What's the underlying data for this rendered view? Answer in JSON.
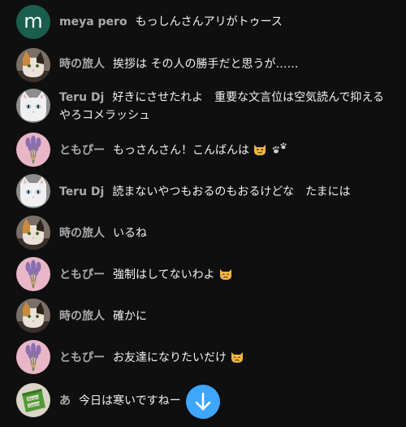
{
  "messages": [
    {
      "author": "meya pero",
      "text": "もっしんさんアリがトゥース",
      "avatar": "letter-m-avatar",
      "avatar_letter": "m"
    },
    {
      "author": "時の旅人",
      "text": "挨拶は その人の勝手だと思うが……",
      "avatar": "calico-cat-avatar"
    },
    {
      "author": "Teru Dj",
      "text": "好きにさせたれよ　重要な文言位は空気読んで抑えるやろコメラッシュ",
      "avatar": "white-cat-avatar"
    },
    {
      "author": "ともぴー",
      "text": "もっさんさん！こんばんは",
      "avatar": "lavender-avatar",
      "emoji": [
        "smiling-cat-emoji",
        "paw-prints-emoji"
      ]
    },
    {
      "author": "Teru Dj",
      "text": "読まないやつもおるのもおるけどな　たまには",
      "avatar": "white-cat-avatar"
    },
    {
      "author": "時の旅人",
      "text": "いるね",
      "avatar": "calico-cat-avatar"
    },
    {
      "author": "ともぴー",
      "text": "強制はしてないわよ",
      "avatar": "lavender-avatar",
      "emoji": [
        "crying-cat-emoji"
      ]
    },
    {
      "author": "時の旅人",
      "text": "確かに",
      "avatar": "calico-cat-avatar"
    },
    {
      "author": "ともぴー",
      "text": "お友達になりたいだけ",
      "avatar": "lavender-avatar",
      "emoji": [
        "crying-cat-emoji"
      ]
    },
    {
      "author": "あ",
      "text": "今日は寒いですねー",
      "avatar": "board-game-avatar"
    }
  ],
  "scroll_button": {
    "icon": "arrow-down-icon",
    "color": "#3ea6ff"
  },
  "colors": {
    "background": "#0f0f0f",
    "author": "#aaaaaa",
    "text": "#f1f1f1"
  }
}
